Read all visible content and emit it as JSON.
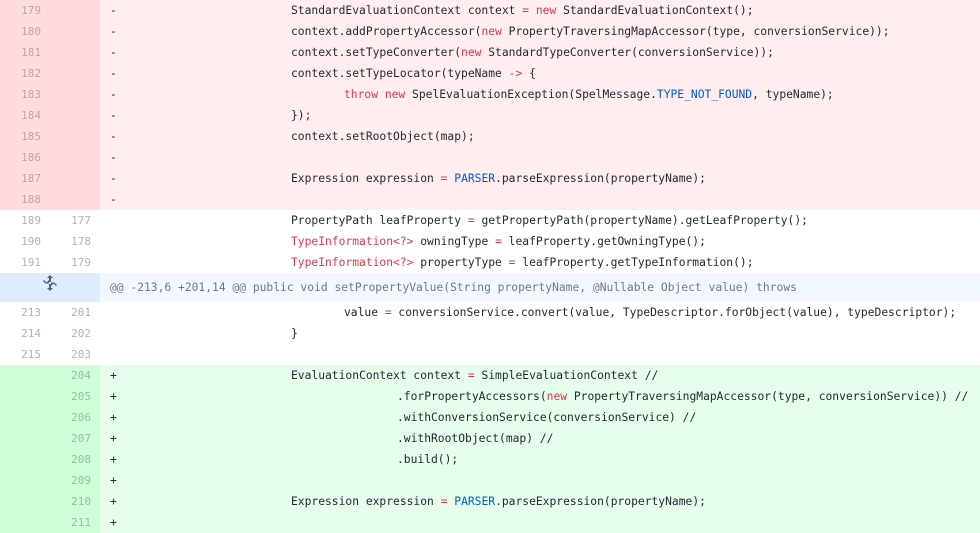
{
  "colors": {
    "deletion_num_bg": "#ffdce0",
    "deletion_code_bg": "#ffeef0",
    "addition_num_bg": "#cdffd8",
    "addition_code_bg": "#e6ffed",
    "hunk_bg": "#f1f8ff",
    "keyword": "#d73a49",
    "constant": "#005cc5"
  },
  "hunk": {
    "header": "@@ -213,6 +201,14 @@ public void setPropertyValue(String propertyName, @Nullable Object value) throws",
    "expand_icon": "unfold-icon"
  },
  "lines": [
    {
      "type": "del",
      "old": "179",
      "new": "",
      "marker": "-",
      "tokens": [
        {
          "t": "\t\t\tStandardEvaluationContext context ",
          "c": "p"
        },
        {
          "t": "=",
          "c": "kw"
        },
        {
          "t": " ",
          "c": "p"
        },
        {
          "t": "new",
          "c": "kw"
        },
        {
          "t": " StandardEvaluationContext();",
          "c": "p"
        }
      ]
    },
    {
      "type": "del",
      "old": "180",
      "new": "",
      "marker": "-",
      "tokens": [
        {
          "t": "\t\t\tcontext.addPropertyAccessor(",
          "c": "p"
        },
        {
          "t": "new",
          "c": "kw"
        },
        {
          "t": " PropertyTraversingMapAccessor(type, conversionService));",
          "c": "p"
        }
      ]
    },
    {
      "type": "del",
      "old": "181",
      "new": "",
      "marker": "-",
      "tokens": [
        {
          "t": "\t\t\tcontext.setTypeConverter(",
          "c": "p"
        },
        {
          "t": "new",
          "c": "kw"
        },
        {
          "t": " StandardTypeConverter(conversionService));",
          "c": "p"
        }
      ]
    },
    {
      "type": "del",
      "old": "182",
      "new": "",
      "marker": "-",
      "tokens": [
        {
          "t": "\t\t\tcontext.setTypeLocator(typeName ",
          "c": "p"
        },
        {
          "t": "->",
          "c": "kw"
        },
        {
          "t": " {",
          "c": "p"
        }
      ]
    },
    {
      "type": "del",
      "old": "183",
      "new": "",
      "marker": "-",
      "tokens": [
        {
          "t": "\t\t\t\t",
          "c": "p"
        },
        {
          "t": "throw",
          "c": "kw"
        },
        {
          "t": " ",
          "c": "p"
        },
        {
          "t": "new",
          "c": "kw"
        },
        {
          "t": " SpelEvaluationException(SpelMessage.",
          "c": "p"
        },
        {
          "t": "TYPE_NOT_FOUND",
          "c": "c"
        },
        {
          "t": ", typeName);",
          "c": "p"
        }
      ]
    },
    {
      "type": "del",
      "old": "184",
      "new": "",
      "marker": "-",
      "tokens": [
        {
          "t": "\t\t\t});",
          "c": "p"
        }
      ]
    },
    {
      "type": "del",
      "old": "185",
      "new": "",
      "marker": "-",
      "tokens": [
        {
          "t": "\t\t\tcontext.setRootObject(map);",
          "c": "p"
        }
      ]
    },
    {
      "type": "del",
      "old": "186",
      "new": "",
      "marker": "-",
      "tokens": []
    },
    {
      "type": "del",
      "old": "187",
      "new": "",
      "marker": "-",
      "tokens": [
        {
          "t": "\t\t\tExpression expression ",
          "c": "p"
        },
        {
          "t": "=",
          "c": "kw"
        },
        {
          "t": " ",
          "c": "p"
        },
        {
          "t": "PARSER",
          "c": "c"
        },
        {
          "t": ".parseExpression(propertyName);",
          "c": "p"
        }
      ]
    },
    {
      "type": "del",
      "old": "188",
      "new": "",
      "marker": "-",
      "tokens": []
    },
    {
      "type": "ctx",
      "old": "189",
      "new": "177",
      "marker": "",
      "tokens": [
        {
          "t": "\t\t\tPropertyPath leafProperty ",
          "c": "p"
        },
        {
          "t": "=",
          "c": "kw"
        },
        {
          "t": " getPropertyPath(propertyName).getLeafProperty();",
          "c": "p"
        }
      ]
    },
    {
      "type": "ctx",
      "old": "190",
      "new": "178",
      "marker": "",
      "tokens": [
        {
          "t": "\t\t\t",
          "c": "p"
        },
        {
          "t": "TypeInformation<?>",
          "c": "kw"
        },
        {
          "t": " owningType ",
          "c": "p"
        },
        {
          "t": "=",
          "c": "kw"
        },
        {
          "t": " leafProperty.getOwningType();",
          "c": "p"
        }
      ]
    },
    {
      "type": "ctx",
      "old": "191",
      "new": "179",
      "marker": "",
      "tokens": [
        {
          "t": "\t\t\t",
          "c": "p"
        },
        {
          "t": "TypeInformation<?>",
          "c": "kw"
        },
        {
          "t": " propertyType ",
          "c": "p"
        },
        {
          "t": "=",
          "c": "kw"
        },
        {
          "t": " leafProperty.getTypeInformation();",
          "c": "p"
        }
      ]
    },
    {
      "type": "hunk"
    },
    {
      "type": "ctx",
      "old": "213",
      "new": "201",
      "marker": "",
      "tokens": [
        {
          "t": "\t\t\t\tvalue ",
          "c": "p"
        },
        {
          "t": "=",
          "c": "kw"
        },
        {
          "t": " conversionService.convert(value, TypeDescriptor.forObject(value), typeDescriptor);",
          "c": "p"
        }
      ]
    },
    {
      "type": "ctx",
      "old": "214",
      "new": "202",
      "marker": "",
      "tokens": [
        {
          "t": "\t\t\t}",
          "c": "p"
        }
      ]
    },
    {
      "type": "ctx",
      "old": "215",
      "new": "203",
      "marker": "",
      "tokens": []
    },
    {
      "type": "add",
      "old": "",
      "new": "204",
      "marker": "+",
      "tokens": [
        {
          "t": "\t\t\tEvaluationContext context ",
          "c": "p"
        },
        {
          "t": "=",
          "c": "kw"
        },
        {
          "t": " SimpleEvaluationContext //",
          "c": "p"
        }
      ]
    },
    {
      "type": "add",
      "old": "",
      "new": "205",
      "marker": "+",
      "tokens": [
        {
          "t": "\t\t\t\t\t.forPropertyAccessors(",
          "c": "p"
        },
        {
          "t": "new",
          "c": "kw"
        },
        {
          "t": " PropertyTraversingMapAccessor(type, conversionService)) //",
          "c": "p"
        }
      ]
    },
    {
      "type": "add",
      "old": "",
      "new": "206",
      "marker": "+",
      "tokens": [
        {
          "t": "\t\t\t\t\t.withConversionService(conversionService) //",
          "c": "p"
        }
      ]
    },
    {
      "type": "add",
      "old": "",
      "new": "207",
      "marker": "+",
      "tokens": [
        {
          "t": "\t\t\t\t\t.withRootObject(map) //",
          "c": "p"
        }
      ]
    },
    {
      "type": "add",
      "old": "",
      "new": "208",
      "marker": "+",
      "tokens": [
        {
          "t": "\t\t\t\t\t.build();",
          "c": "p"
        }
      ]
    },
    {
      "type": "add",
      "old": "",
      "new": "209",
      "marker": "+",
      "tokens": []
    },
    {
      "type": "add",
      "old": "",
      "new": "210",
      "marker": "+",
      "tokens": [
        {
          "t": "\t\t\tExpression expression ",
          "c": "p"
        },
        {
          "t": "=",
          "c": "kw"
        },
        {
          "t": " ",
          "c": "p"
        },
        {
          "t": "PARSER",
          "c": "c"
        },
        {
          "t": ".parseExpression(propertyName);",
          "c": "p"
        }
      ]
    },
    {
      "type": "add",
      "old": "",
      "new": "211",
      "marker": "+",
      "tokens": []
    }
  ]
}
